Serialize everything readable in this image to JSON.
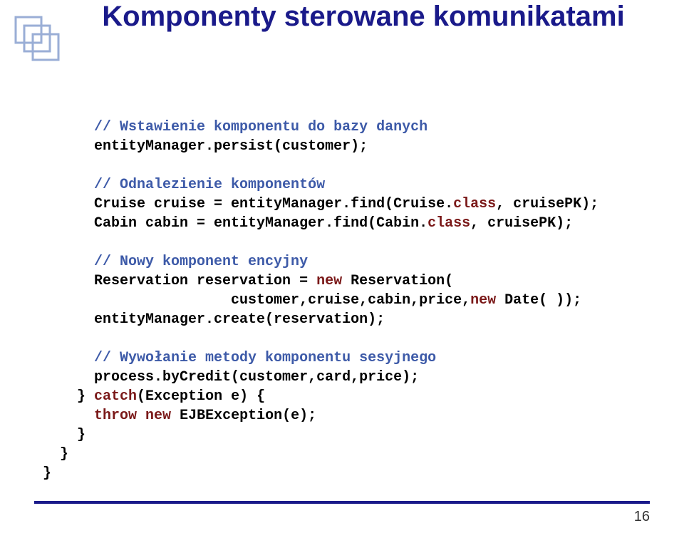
{
  "title": "Komponenty sterowane komunikatami",
  "code": {
    "c1": "// Wstawienie komponentu do bazy danych",
    "l1a": "entityManager.persist(customer);",
    "c2": "// Odnalezienie komponentów",
    "l2a": "Cruise cruise = entityManager.find(Cruise.",
    "l2b": "class",
    "l2c": ", cruisePK);",
    "l3a": "Cabin cabin = entityManager.find(Cabin.",
    "l3b": "class",
    "l3c": ", cruisePK);",
    "c3": "// Nowy komponent encyjny",
    "l4a": "Reservation reservation = ",
    "l4b": "new",
    "l4c": " Reservation(",
    "l5a": "customer,cruise,cabin,price,",
    "l5b": "new",
    "l5c": " Date( ));",
    "l6a": "entityManager.create(reservation);",
    "c4": "// Wywołanie metody komponentu sesyjnego",
    "l7a": "process.byCredit(customer,card,price);",
    "l8a": "} ",
    "l8b": "catch",
    "l8c": "(Exception e) {",
    "l9a": "throw",
    "l9b": " ",
    "l9c": "new",
    "l9d": " EJBException(e);",
    "l10": "}",
    "l11": "}",
    "l12": "}"
  },
  "pageNumber": "16"
}
